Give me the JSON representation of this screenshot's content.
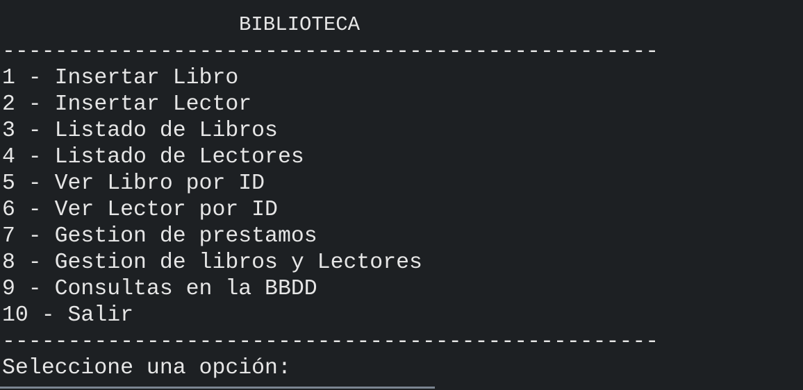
{
  "header": {
    "title": "BIBLIOTECA",
    "separator": "--------------------------------------------------"
  },
  "menu": {
    "items": [
      {
        "label": "1 - Insertar Libro"
      },
      {
        "label": "2 - Insertar Lector"
      },
      {
        "label": "3 - Listado de Libros"
      },
      {
        "label": "4 - Listado de Lectores"
      },
      {
        "label": "5 - Ver Libro por ID"
      },
      {
        "label": "6 - Ver Lector por ID"
      },
      {
        "label": "7 - Gestion de prestamos"
      },
      {
        "label": "8 - Gestion de libros y Lectores"
      },
      {
        "label": "9 - Consultas en la BBDD"
      },
      {
        "label": "10 - Salir"
      }
    ]
  },
  "footer": {
    "separator": "--------------------------------------------------",
    "prompt": "Seleccione una opción:"
  },
  "colors": {
    "background": "#1d2023",
    "text": "#e6e6e6",
    "scrollbar": "#7b8591"
  }
}
